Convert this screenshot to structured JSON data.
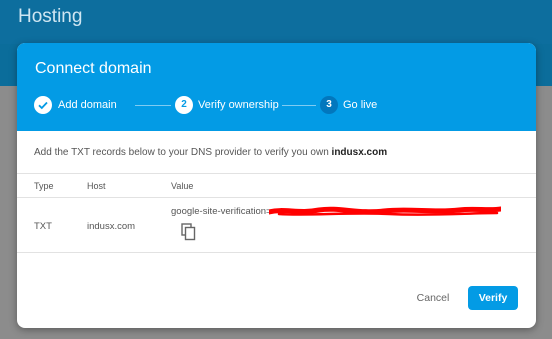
{
  "app": {
    "title": "Hosting"
  },
  "dialog": {
    "title": "Connect domain",
    "steps": [
      {
        "label": "Add domain",
        "marker": "check",
        "state": "completed"
      },
      {
        "label": "Verify ownership",
        "marker": "2",
        "state": "active"
      },
      {
        "label": "Go live",
        "marker": "3",
        "state": "upcoming"
      }
    ],
    "intro_text": "Add the TXT records below to your DNS provider to verify you own",
    "domain": "indusx.com",
    "table": {
      "columns": [
        "Type",
        "Host",
        "Value"
      ],
      "rows": [
        {
          "type": "TXT",
          "host": "indusx.com",
          "value": "google-site-verification="
        }
      ]
    },
    "buttons": {
      "cancel": "Cancel",
      "verify": "Verify"
    }
  },
  "colors": {
    "header_bg": "#039be5",
    "app_bar": "#0d6e9e",
    "primary_button": "#039be5",
    "redaction": "#ff0000"
  }
}
